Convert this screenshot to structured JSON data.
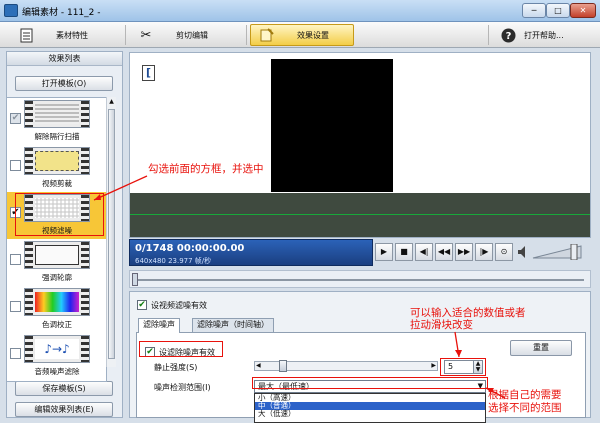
{
  "window": {
    "title": "编辑素材 - 111_2 -",
    "controls": [
      "─",
      "□",
      "✕"
    ]
  },
  "toolbar": {
    "properties_label": "素材特性",
    "cut_label": "剪切编辑",
    "effects_label": "效果设置",
    "help_label": "打开帮助..."
  },
  "left_panel": {
    "title": "效果列表",
    "open_template": "打开模板(O)",
    "save_template": "保存模板(S)",
    "edit_list": "编辑效果列表(E)",
    "effects": [
      {
        "label": "解除隔行扫描",
        "checked": true
      },
      {
        "label": "视频剪裁",
        "checked": false
      },
      {
        "label": "视频滤噪",
        "checked": true
      },
      {
        "label": "强调轮廓",
        "checked": false
      },
      {
        "label": "色调校正",
        "checked": false
      },
      {
        "label": "音频噪声滤除",
        "checked": false
      }
    ]
  },
  "preview": {
    "bracket": "["
  },
  "timecode": {
    "main": "0/1748  00:00:00.00",
    "sub": "640x480 23.977 帧/秒"
  },
  "transport": {
    "buttons": [
      "▶",
      "■",
      "◀|",
      "◀◀",
      "▶▶",
      "|▶",
      "⊙"
    ]
  },
  "settings": {
    "enable_label": "设视频滤噪有效",
    "tabs": [
      "滤除噪声",
      "滤除噪声（时间轴）"
    ],
    "denoise_enable_label": "设滤除噪声有效",
    "reset_label": "重置",
    "strength_label": "静止强度(S)",
    "strength_value": "5",
    "range_label": "噪声检测范围(I)",
    "range_selected": "最大（最低速）",
    "range_options": [
      "小（高速）",
      "中（普通）",
      "大（低速）"
    ]
  },
  "annotations": {
    "check_hint": "勾选前面的方框，并选中",
    "input_hint_1": "可以输入适合的数值或者",
    "input_hint_2": "拉动滑块改变",
    "range_hint_1": "根据自己的需要",
    "range_hint_2": "选择不同的范围"
  }
}
